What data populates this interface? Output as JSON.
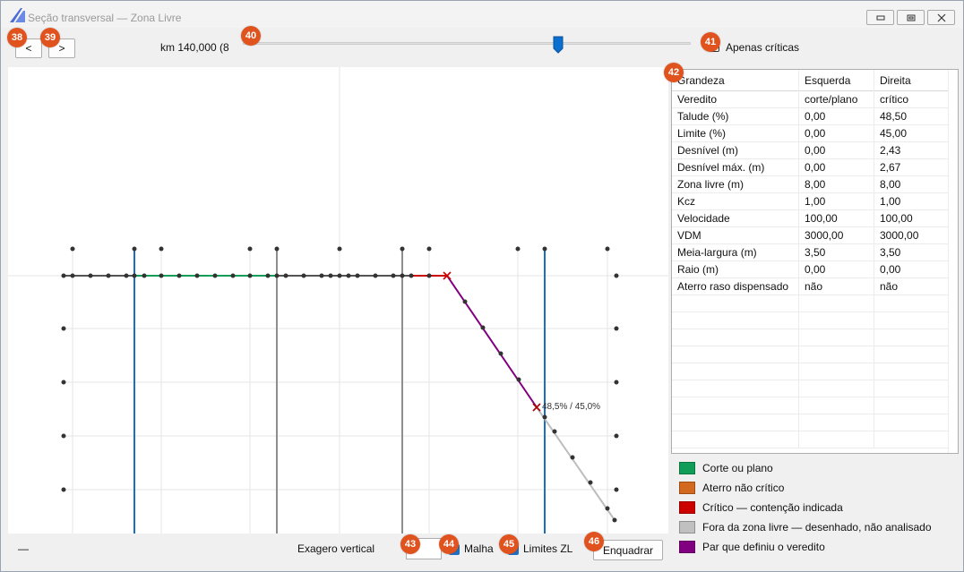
{
  "window": {
    "title": "Seção transversal — Zona Livre",
    "controls": [
      "minimize-icon",
      "maximize-icon",
      "close-icon"
    ]
  },
  "toolbar": {
    "prev_label": "<",
    "next_label": ">",
    "km_label": "km 140,000  (8",
    "slider_position": 0.7,
    "apenas_criticas_label": "Apenas críticas",
    "apenas_criticas_checked": false
  },
  "badges": {
    "b38": "38",
    "b39": "39",
    "b40": "40",
    "b41": "41",
    "b42": "42",
    "b43": "43",
    "b44": "44",
    "b45": "45",
    "b46": "46"
  },
  "plot": {
    "annotation": "48,5% / 45,0%"
  },
  "table": {
    "headers": [
      "Grandeza",
      "Esquerda",
      "Direita"
    ],
    "rows": [
      [
        "Veredito",
        "corte/plano",
        "crítico"
      ],
      [
        "Talude (%)",
        "0,00",
        "48,50"
      ],
      [
        "Limite (%)",
        "0,00",
        "45,00"
      ],
      [
        "Desnível (m)",
        "0,00",
        "2,43"
      ],
      [
        "Desnível máx. (m)",
        "0,00",
        "2,67"
      ],
      [
        "Zona livre (m)",
        "8,00",
        "8,00"
      ],
      [
        "Kcz",
        "1,00",
        "1,00"
      ],
      [
        "Velocidade",
        "100,00",
        "100,00"
      ],
      [
        "VDM",
        "3000,00",
        "3000,00"
      ],
      [
        "Meia-largura (m)",
        "3,50",
        "3,50"
      ],
      [
        "Raio (m)",
        "0,00",
        "0,00"
      ],
      [
        "Aterro raso dispensado",
        "não",
        "não"
      ]
    ]
  },
  "legend": [
    {
      "label": "Corte ou plano",
      "color": "#0f9d58"
    },
    {
      "label": "Aterro não crítico",
      "color": "#d2691e"
    },
    {
      "label": "Crítico — contenção indicada",
      "color": "#cc0000"
    },
    {
      "label": "Fora da zona livre — desenhado, não analisado",
      "color": "#c0c0c0"
    },
    {
      "label": "Par que definiu o veredito",
      "color": "#800080"
    }
  ],
  "bottom": {
    "status": "—",
    "exagero_label": "Exagero vertical",
    "exagero_value": "",
    "malha_label": "Malha",
    "malha_checked": true,
    "limites_label": "Limites ZL",
    "limites_checked": true,
    "enquadrar_label": "Enquadrar"
  }
}
